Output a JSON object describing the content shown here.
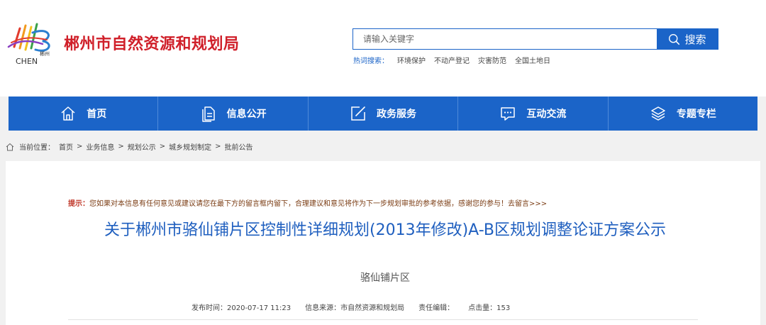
{
  "site": {
    "logo_text_cn": "郴州",
    "logo_text_en": "CHEN",
    "title": "郴州市自然资源和规划局"
  },
  "search": {
    "placeholder": "请输入关键字",
    "button_label": "搜索",
    "hot_label": "热词搜索：",
    "hot_words": [
      "环境保护",
      "不动产登记",
      "灾害防范",
      "全国土地日"
    ]
  },
  "nav": {
    "items": [
      {
        "label": "首页",
        "icon": "home-icon"
      },
      {
        "label": "信息公开",
        "icon": "document-icon"
      },
      {
        "label": "政务服务",
        "icon": "edit-icon"
      },
      {
        "label": "互动交流",
        "icon": "chat-icon"
      },
      {
        "label": "专题专栏",
        "icon": "layers-icon"
      }
    ]
  },
  "breadcrumb": {
    "prefix": "当前位置：",
    "items": [
      "首页",
      "业务信息",
      "规划公示",
      "城乡规划制定",
      "批前公告"
    ],
    "separator": ">"
  },
  "article": {
    "tip_label": "提示：",
    "tip_text": "您如果对本信息有任何意见或建议请您在最下方的留言框内留下，合理建议和意见将作为下一步规划审批的参考依据，感谢您的参与！",
    "tip_link": "去留言>>>",
    "title": "关于郴州市骆仙铺片区控制性详细规划(2013年修改)A-B区规划调整论证方案公示",
    "subtitle": "骆仙铺片区",
    "meta": {
      "publish_time": "发布时间：2020-07-17 11:23",
      "source": "信息来源：市自然资源和规划局",
      "editor": "责任编辑：",
      "hits": "点击量：153"
    }
  },
  "colors": {
    "brand_blue": "#1b64c8",
    "title_red": "#d0202a",
    "title_blue": "#1f5fbf"
  }
}
